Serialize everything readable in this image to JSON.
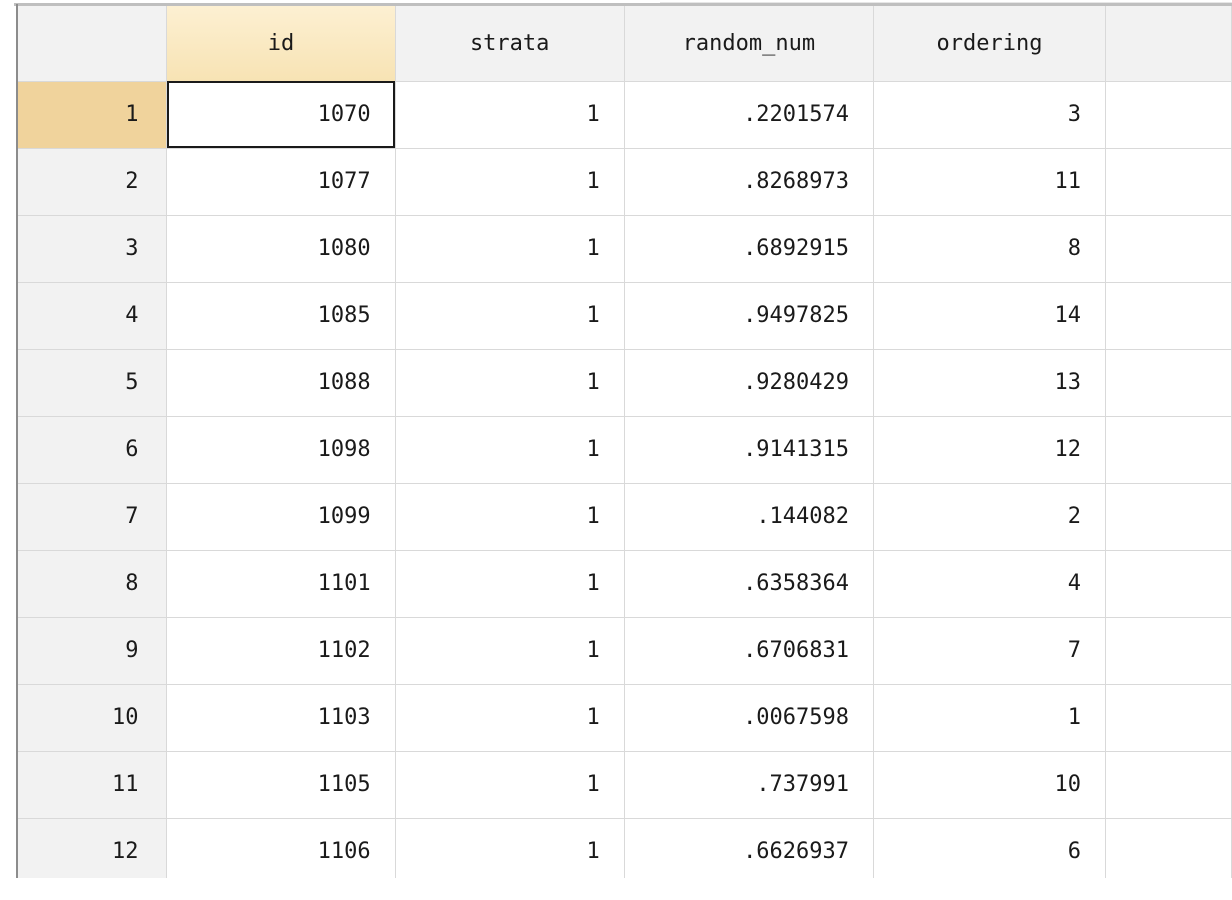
{
  "data_editor": {
    "columns": [
      {
        "name": "id"
      },
      {
        "name": "strata"
      },
      {
        "name": "random_num"
      },
      {
        "name": "ordering"
      }
    ],
    "selected_row": 1,
    "selected_column": "id",
    "rows": [
      {
        "n": "1",
        "id": "1070",
        "strata": "1",
        "random_num": ".2201574",
        "ordering": "3"
      },
      {
        "n": "2",
        "id": "1077",
        "strata": "1",
        "random_num": ".8268973",
        "ordering": "11"
      },
      {
        "n": "3",
        "id": "1080",
        "strata": "1",
        "random_num": ".6892915",
        "ordering": "8"
      },
      {
        "n": "4",
        "id": "1085",
        "strata": "1",
        "random_num": ".9497825",
        "ordering": "14"
      },
      {
        "n": "5",
        "id": "1088",
        "strata": "1",
        "random_num": ".9280429",
        "ordering": "13"
      },
      {
        "n": "6",
        "id": "1098",
        "strata": "1",
        "random_num": ".9141315",
        "ordering": "12"
      },
      {
        "n": "7",
        "id": "1099",
        "strata": "1",
        "random_num": ".144082",
        "ordering": "2"
      },
      {
        "n": "8",
        "id": "1101",
        "strata": "1",
        "random_num": ".6358364",
        "ordering": "4"
      },
      {
        "n": "9",
        "id": "1102",
        "strata": "1",
        "random_num": ".6706831",
        "ordering": "7"
      },
      {
        "n": "10",
        "id": "1103",
        "strata": "1",
        "random_num": ".0067598",
        "ordering": "1"
      },
      {
        "n": "11",
        "id": "1105",
        "strata": "1",
        "random_num": ".737991",
        "ordering": "10"
      },
      {
        "n": "12",
        "id": "1106",
        "strata": "1",
        "random_num": ".6626937",
        "ordering": "6"
      }
    ]
  }
}
